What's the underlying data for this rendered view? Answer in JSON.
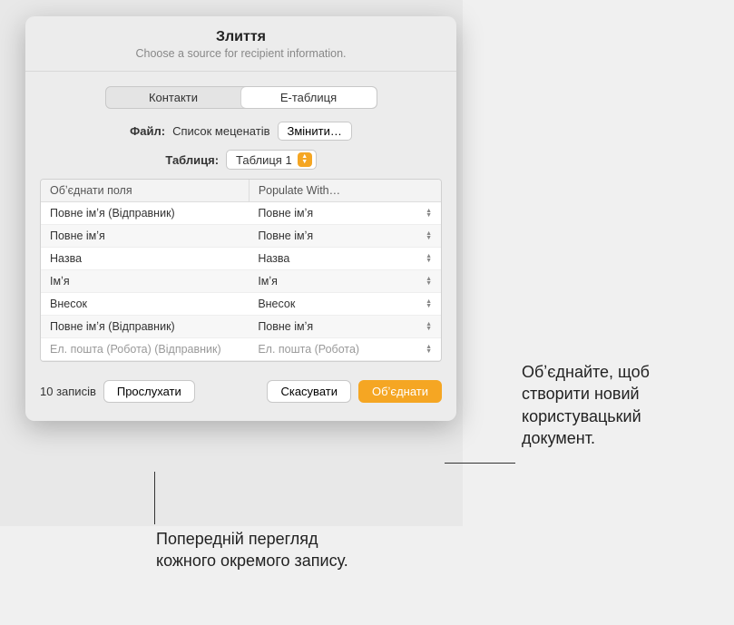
{
  "dialog": {
    "title": "Злиття",
    "subtitle": "Choose a source for recipient information."
  },
  "tabs": {
    "contacts": "Контакти",
    "spreadsheet": "Е-таблиця"
  },
  "file": {
    "label": "Файл:",
    "name": "Список меценатів",
    "change": "Змінити…"
  },
  "table_select": {
    "label": "Таблиця:",
    "value": "Таблиця 1"
  },
  "columns": {
    "merge_fields": "Обʼєднати поля",
    "populate_with": "Populate With…"
  },
  "rows": [
    {
      "field": "Повне імʼя (Відправник)",
      "populate": "Повне імʼя"
    },
    {
      "field": "Повне імʼя",
      "populate": "Повне імʼя"
    },
    {
      "field": "Назва",
      "populate": "Назва"
    },
    {
      "field": "Імʼя",
      "populate": "Імʼя"
    },
    {
      "field": "Внесок",
      "populate": "Внесок"
    },
    {
      "field": "Повне імʼя (Відправник)",
      "populate": "Повне імʼя"
    },
    {
      "field": "Ел. пошта (Робота) (Відправник)",
      "populate": "Ел. пошта (Робота)"
    }
  ],
  "footer": {
    "records": "10 записів",
    "preview": "Прослухати",
    "cancel": "Скасувати",
    "merge": "Обʼєднати"
  },
  "callouts": {
    "right": "Обʼєднайте, щоб створити новий користувацький документ.",
    "bottom": "Попередній перегляд кожного окремого запису."
  }
}
